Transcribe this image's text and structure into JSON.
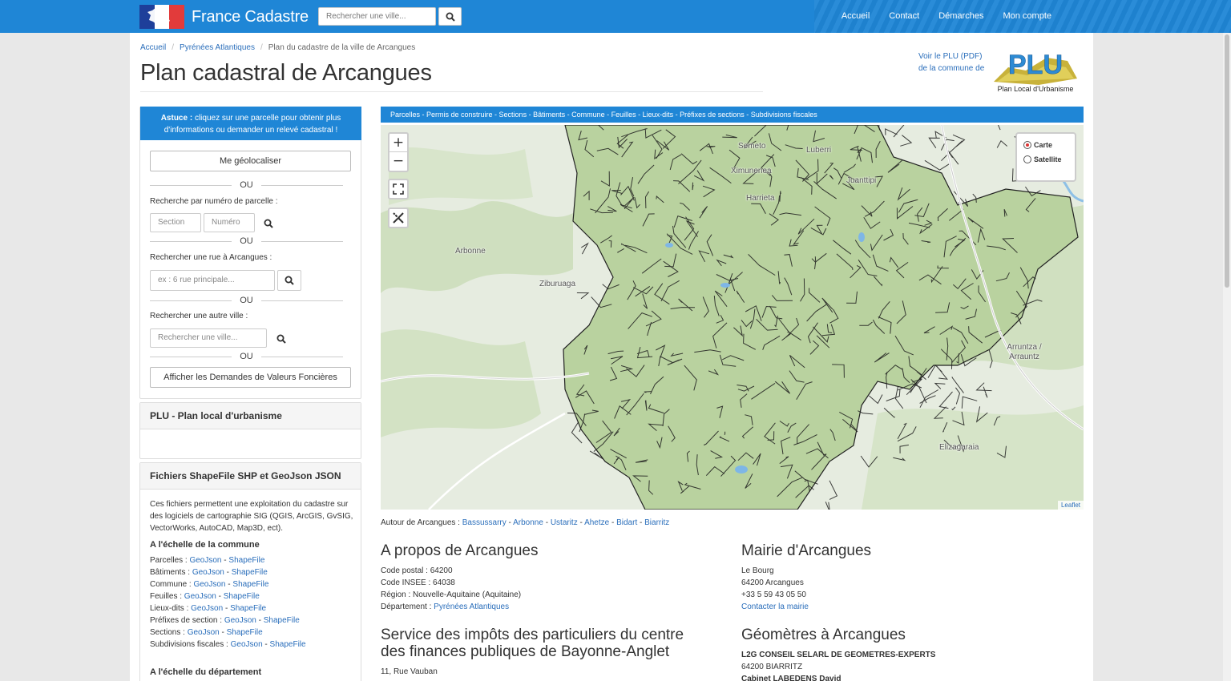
{
  "navbar": {
    "brand": "France Cadastre",
    "search_placeholder": "Rechercher une ville...",
    "links": [
      "Accueil",
      "Contact",
      "Démarches",
      "Mon compte"
    ]
  },
  "breadcrumb": [
    "Accueil",
    "Pyrénées Atlantiques",
    "Plan du cadastre de la ville de Arcangues"
  ],
  "title": "Plan cadastral de Arcangues",
  "plu_link": [
    "Voir le PLU (PDF)",
    "de la commune de"
  ],
  "plu_logo": {
    "letters": "PLU",
    "caption": "Plan Local d'Urbanisme"
  },
  "sidebar": {
    "tip_bold": "Astuce :",
    "tip_text": "cliquez sur une parcelle pour obtenir plus d'informations ou demander un relevé cadastral !",
    "geolocate": "Me géolocaliser",
    "or": "OU",
    "parcel_label": "Recherche par numéro de parcelle :",
    "section_placeholder": "Section",
    "number_placeholder": "Numéro",
    "street_label": "Rechercher une rue à Arcangues :",
    "street_placeholder": "ex : 6 rue principale...",
    "city_label": "Rechercher une autre ville :",
    "city_placeholder": "Rechercher une ville...",
    "dvf_button": "Afficher les Demandes de Valeurs Foncières",
    "plu_heading": "PLU - Plan local d'urbanisme",
    "files_heading": "Fichiers ShapeFile SHP et GeoJson JSON",
    "files_intro": "Ces fichiers permettent une exploitation du cadastre sur des logiciels de cartographie SIG (QGIS, ArcGIS, GvSIG, VectorWorks, AutoCAD, Map3D, ect).",
    "commune_heading": "A l'échelle de la commune",
    "files": [
      {
        "label": "Parcelles :"
      },
      {
        "label": "Bâtiments :"
      },
      {
        "label": "Commune :"
      },
      {
        "label": "Feuilles :"
      },
      {
        "label": "Lieux-dits :"
      },
      {
        "label": "Préfixes de section :"
      },
      {
        "label": "Sections :"
      },
      {
        "label": "Subdivisions fiscales :"
      }
    ],
    "geojson": "GeoJson",
    "dash": "-",
    "shapefile": "ShapeFile",
    "dept_heading": "A l'échelle du département"
  },
  "map": {
    "layers": [
      "Parcelles",
      "Permis de construire",
      "Sections",
      "Bâtiments",
      "Commune",
      "Feuilles",
      "Lieux-dits",
      "Préfixes de sections",
      "Subdivisions fiscales"
    ],
    "zoom_in": "+",
    "zoom_out": "−",
    "layer_options": [
      "Carte",
      "Satellite"
    ],
    "places": [
      "Semeto",
      "Luberri",
      "Ximunenea",
      "Juanttipi",
      "Harrieta",
      "Arbonne",
      "Ziburuaga",
      "Arruntza / Arrauntz",
      "Elizagaraia"
    ],
    "attribution": "Leaflet"
  },
  "around": {
    "label": "Autour de Arcangues :",
    "towns": [
      "Bassussarry",
      "Arbonne",
      "Ustaritz",
      "Ahetze",
      "Bidart",
      "Biarritz"
    ]
  },
  "about": {
    "heading": "A propos de Arcangues",
    "lines": [
      "Code postal : 64200",
      "Code INSEE : 64038",
      "Région : Nouvelle-Aquitaine (Aquitaine)"
    ],
    "dept_label": "Département :",
    "dept_value": "Pyrénées Atlantiques"
  },
  "mairie": {
    "heading": "Mairie d'Arcangues",
    "lines": [
      "Le Bourg",
      "64200 Arcangues",
      "+33 5 59 43 05 50"
    ],
    "contact": "Contacter la mairie"
  },
  "impots": {
    "heading_1": "Service des impôts des particuliers du centre",
    "heading_2": "des finances publiques de Bayonne-Anglet",
    "address": "11, Rue Vauban"
  },
  "geometres": {
    "heading": "Géomètres à Arcangues",
    "firm": "L2G CONSEIL SELARL DE GEOMETRES-EXPERTS",
    "city": "64200 BIARRITZ",
    "firm2": "Cabinet LABEDENS David"
  },
  "colors": {
    "primary": "#1f86d6",
    "link": "#2a6ebb",
    "map_green": "#bcd3a2"
  }
}
